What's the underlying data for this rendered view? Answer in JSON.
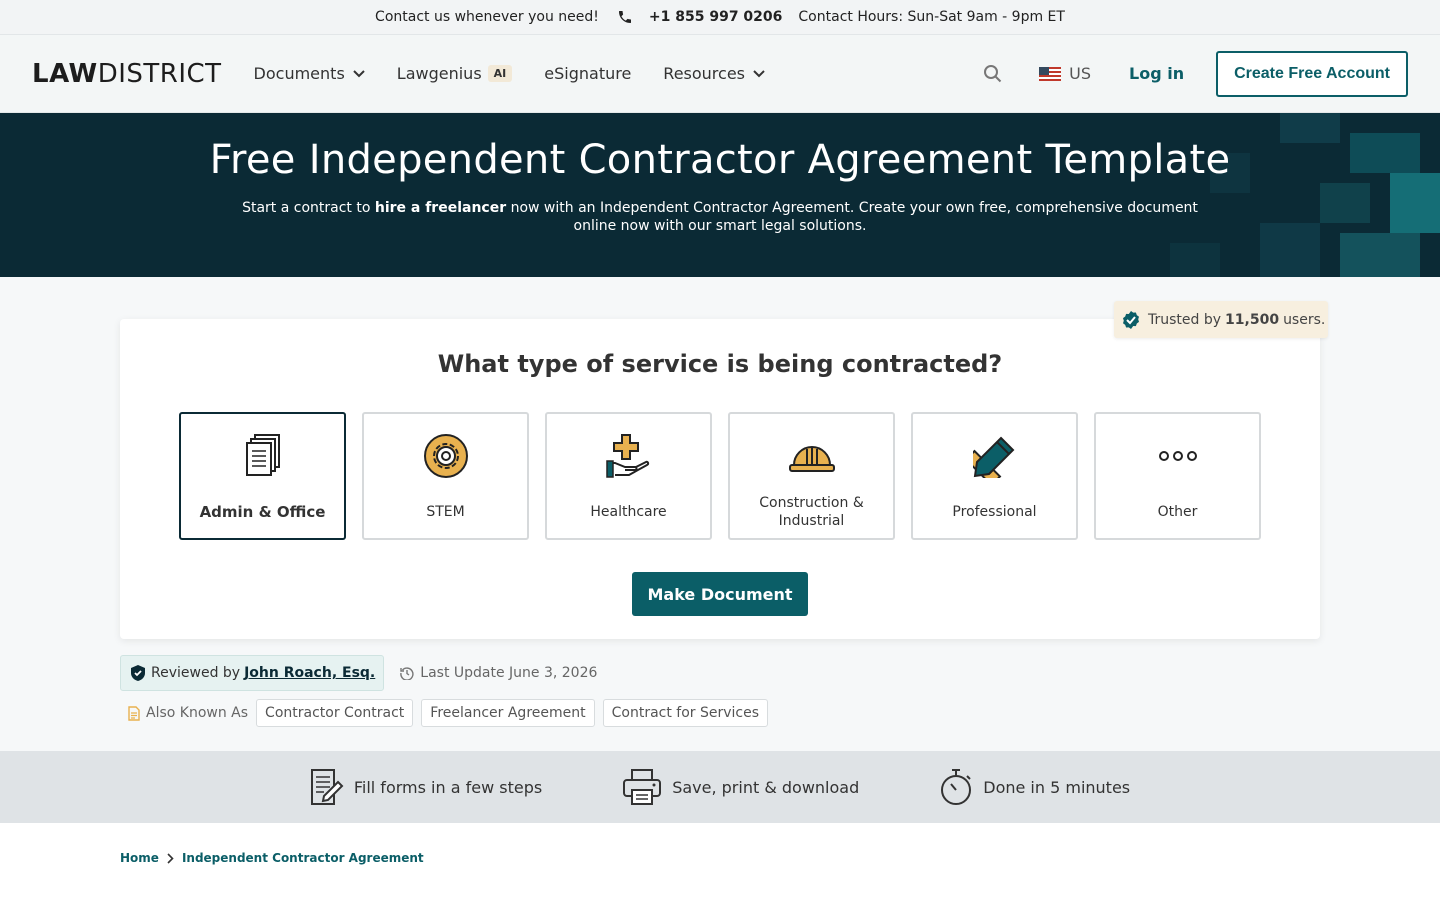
{
  "topbar": {
    "contact_text": "Contact us whenever you need!",
    "phone": "+1 855 997 0206",
    "hours": "Contact Hours: Sun-Sat 9am - 9pm ET"
  },
  "header": {
    "logo_bold": "LAW",
    "logo_rest": "DISTRICT",
    "nav": [
      {
        "label": "Documents"
      },
      {
        "label": "Lawgenius",
        "badge": "AI"
      },
      {
        "label": "eSignature"
      },
      {
        "label": "Resources"
      }
    ],
    "locale": "US",
    "login": "Log in",
    "create_account": "Create Free Account"
  },
  "hero": {
    "title": "Free Independent Contractor Agreement Template",
    "desc_pre": "Start a contract to ",
    "desc_bold": "hire a freelancer",
    "desc_post": " now with an Independent Contractor Agreement. Create your own free, comprehensive document online now with our smart legal solutions."
  },
  "trusted": {
    "pre": "Trusted by",
    "count": "11,500",
    "post": "users."
  },
  "form": {
    "question": "What type of service is being contracted?",
    "options": [
      {
        "label": "Admin & Office",
        "icon": "documents-icon",
        "selected": true
      },
      {
        "label": "STEM",
        "icon": "gear-icon",
        "selected": false
      },
      {
        "label": "Healthcare",
        "icon": "medical-hand-icon",
        "selected": false
      },
      {
        "label": "Construction & Industrial",
        "icon": "hard-hat-icon",
        "selected": false
      },
      {
        "label": "Professional",
        "icon": "pencil-ruler-icon",
        "selected": false
      },
      {
        "label": "Other",
        "icon": "ellipsis-icon",
        "selected": false
      }
    ],
    "submit": "Make Document"
  },
  "meta": {
    "reviewed_pre": "Reviewed by",
    "reviewer": "John Roach, Esq.",
    "last_update": "Last Update June 3, 2026",
    "aka_label": "Also Known As",
    "aka_tags": [
      "Contractor Contract",
      "Freelancer Agreement",
      "Contract for Services"
    ]
  },
  "features": [
    {
      "label": "Fill forms in a few steps",
      "icon": "form-edit-icon"
    },
    {
      "label": "Save, print & download",
      "icon": "printer-icon"
    },
    {
      "label": "Done in 5 minutes",
      "icon": "stopwatch-icon"
    }
  ],
  "breadcrumb": {
    "home": "Home",
    "current": "Independent Contractor Agreement"
  },
  "colors": {
    "brand_teal": "#0b5e67",
    "hero_bg": "#0b2a35",
    "trusted_bg": "#f7efdf",
    "icon_accent": "#e8b14f"
  }
}
